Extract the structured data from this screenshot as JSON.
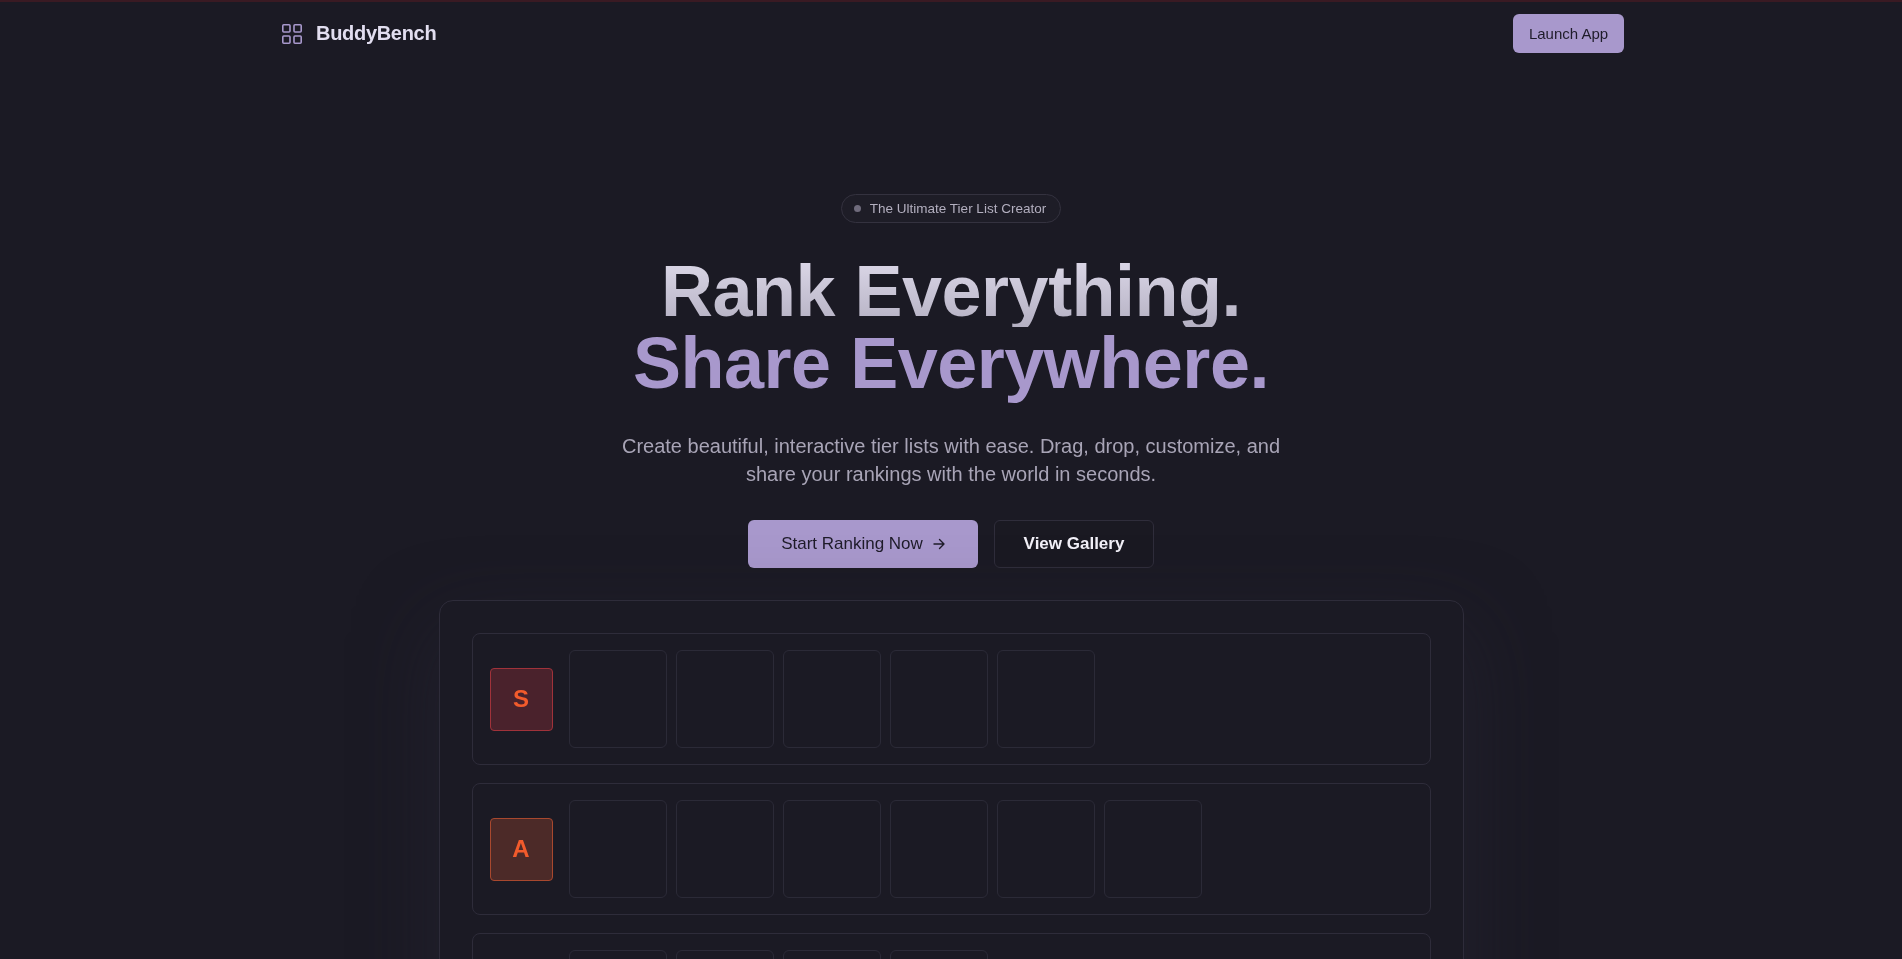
{
  "header": {
    "brand": "BuddyBench",
    "launch_button": "Launch App"
  },
  "hero": {
    "badge": "The Ultimate Tier List Creator",
    "headline": "Rank Everything.",
    "headline_accent": "Share Everywhere.",
    "subtitle": "Create beautiful, interactive tier lists with ease. Drag, drop, customize, and share your rankings with the world in seconds.",
    "buttons": [
      {
        "label": "Start Ranking Now",
        "kind": "primary"
      },
      {
        "label": "View Gallery",
        "kind": "secondary"
      }
    ]
  },
  "tier_list": {
    "tiers": [
      {
        "label": "S",
        "color": "#a0323a",
        "slots": [
          {
            "kind": "empty"
          },
          {
            "kind": "empty"
          },
          {
            "kind": "empty"
          },
          {
            "kind": "empty"
          },
          {
            "kind": "empty"
          }
        ]
      },
      {
        "label": "A",
        "color": "#a8482e",
        "slots": [
          {
            "kind": "empty"
          },
          {
            "kind": "empty"
          },
          {
            "kind": "empty"
          },
          {
            "kind": "empty"
          },
          {
            "kind": "empty"
          },
          {
            "kind": "empty"
          }
        ]
      },
      {
        "slots": [
          {
            "kind": "empty"
          },
          {
            "kind": "empty"
          },
          {
            "kind": "empty"
          },
          {
            "kind": "empty"
          }
        ]
      }
    ]
  }
}
